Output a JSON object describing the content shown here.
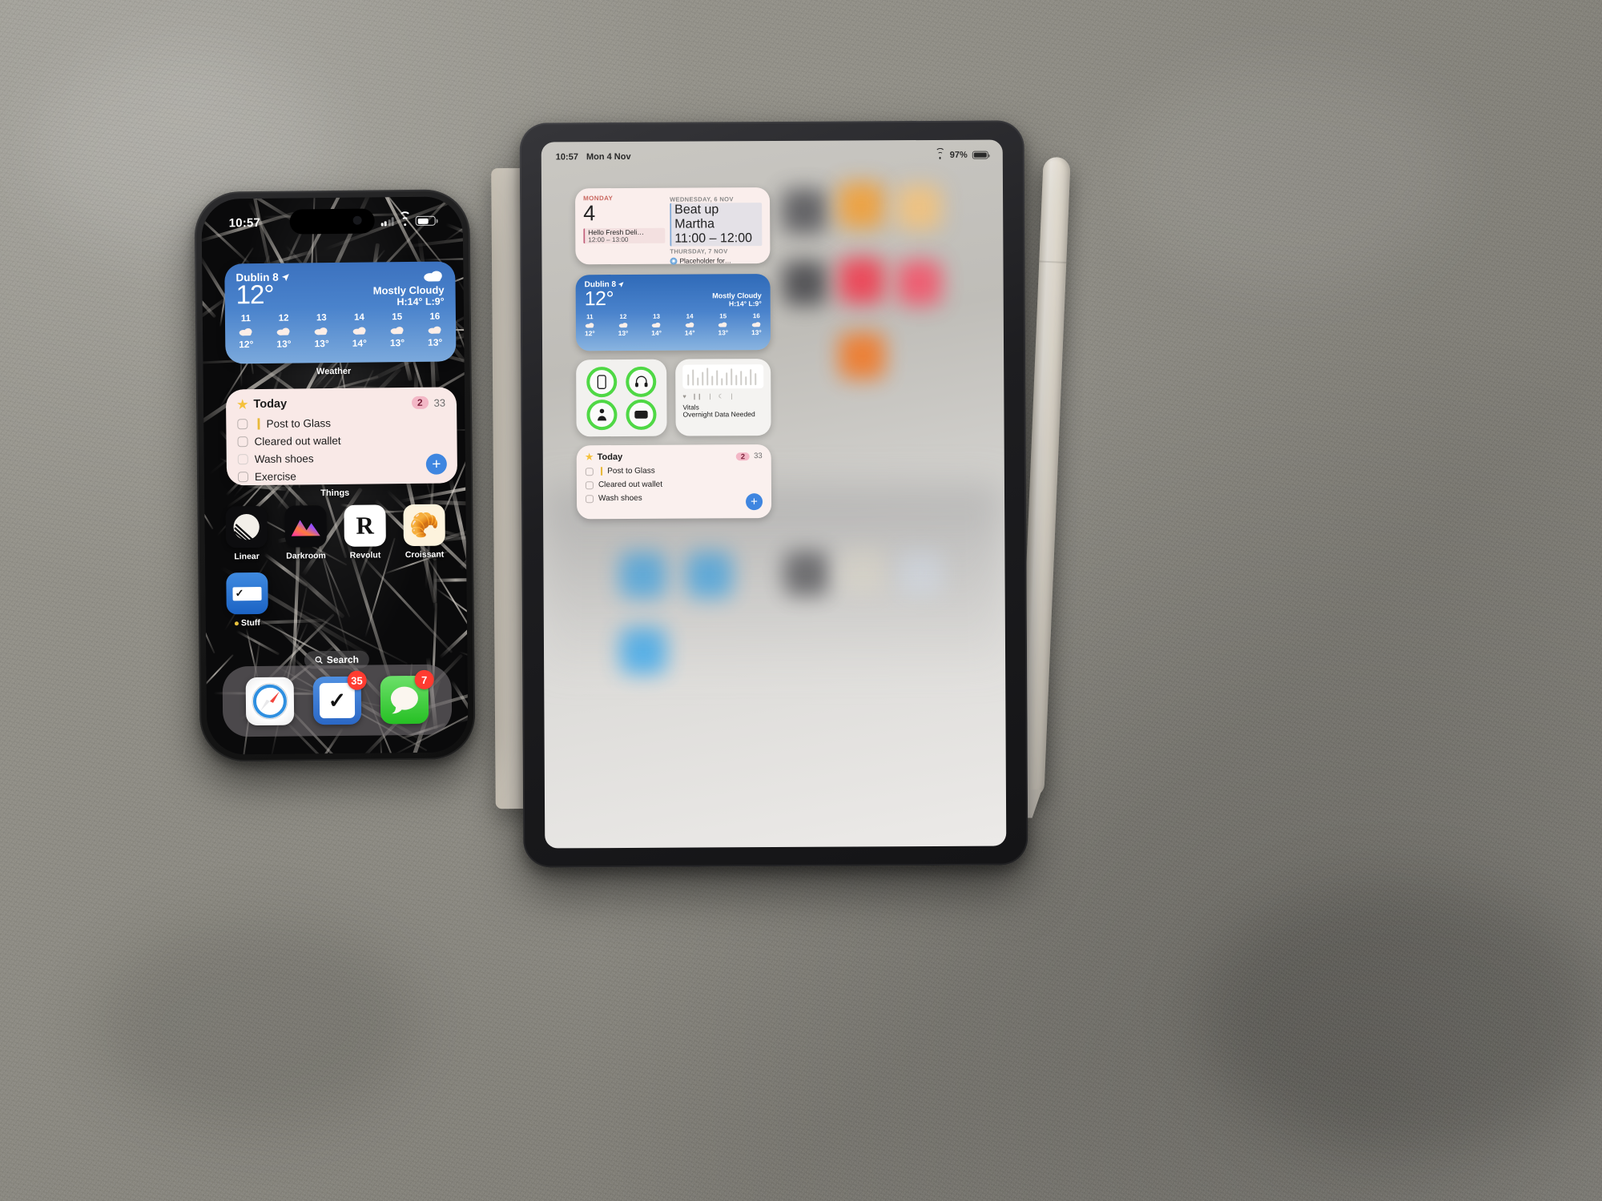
{
  "scene": {
    "description": "Photo of an iPhone and an iPad mini lying on a grey felt desk mat with an Apple Pencil",
    "surface_color": "#8b8981"
  },
  "iphone": {
    "status_bar": {
      "time": "10:57",
      "wifi_icon": "wifi-icon",
      "signal_icon": "cellular-signal-icon",
      "battery_icon": "battery-icon"
    },
    "weather_widget": {
      "city": "Dublin 8",
      "location_icon": "location-arrow-icon",
      "temperature": "12°",
      "condition": "Mostly Cloudy",
      "high_low": "H:14° L:9°",
      "condition_icon": "cloud-icon",
      "hours": [
        {
          "hour": "11",
          "icon": "cloud-icon",
          "temp": "12°"
        },
        {
          "hour": "12",
          "icon": "cloud-icon",
          "temp": "13°"
        },
        {
          "hour": "13",
          "icon": "cloud-icon",
          "temp": "13°"
        },
        {
          "hour": "14",
          "icon": "cloud-icon",
          "temp": "14°"
        },
        {
          "hour": "15",
          "icon": "cloud-icon",
          "temp": "13°"
        },
        {
          "hour": "16",
          "icon": "cloud-icon",
          "temp": "13°"
        }
      ],
      "label": "Weather"
    },
    "things_widget": {
      "title": "Today",
      "star_icon": "star-icon",
      "badge": "2",
      "count": "33",
      "tasks": [
        {
          "text": "Post to Glass",
          "flagged": true
        },
        {
          "text": "Cleared out wallet",
          "flagged": false
        },
        {
          "text": "Wash shoes",
          "flagged": false
        },
        {
          "text": "Exercise",
          "flagged": false
        }
      ],
      "add_label": "+",
      "label": "Things"
    },
    "apps": [
      {
        "name": "Linear",
        "icon": "linear-app-icon"
      },
      {
        "name": "Darkroom",
        "icon": "darkroom-app-icon"
      },
      {
        "name": "Revolut",
        "icon": "revolut-app-icon",
        "glyph": "R"
      },
      {
        "name": "Croissant",
        "icon": "croissant-app-icon",
        "glyph": "🥐"
      },
      {
        "name": "Stuff",
        "icon": "stuff-app-icon",
        "has_dot": true
      }
    ],
    "search": {
      "label": "Search",
      "icon": "search-icon"
    },
    "dock": [
      {
        "name": "Safari",
        "icon": "safari-app-icon",
        "badge": ""
      },
      {
        "name": "Things",
        "icon": "things-app-icon",
        "badge": "35"
      },
      {
        "name": "Messages",
        "icon": "messages-app-icon",
        "badge": "7"
      }
    ]
  },
  "ipad": {
    "status_bar": {
      "time": "10:57",
      "date": "Mon 4 Nov",
      "battery_text": "97%",
      "wifi_icon": "wifi-icon",
      "battery_icon": "battery-icon"
    },
    "calendar_widget": {
      "left": {
        "weekday": "MONDAY",
        "day_number": "4",
        "event": {
          "title": "Hello Fresh Deli…",
          "time": "12:00 – 13:00"
        }
      },
      "right": {
        "day_header_1": "WEDNESDAY, 6 NOV",
        "event_1": {
          "title": "Beat up Martha",
          "time": "11:00 – 12:00"
        },
        "day_header_2": "THURSDAY, 7 NOV",
        "event_2": {
          "title": "Placeholder for…",
          "icon": "calendar-dot-icon"
        }
      }
    },
    "weather_widget": {
      "city": "Dublin 8",
      "location_icon": "location-arrow-icon",
      "temperature": "12°",
      "condition": "Mostly Cloudy",
      "high_low": "H:14° L:9°",
      "hours": [
        {
          "hour": "11",
          "icon": "cloud-icon",
          "temp": "12°"
        },
        {
          "hour": "12",
          "icon": "cloud-icon",
          "temp": "13°"
        },
        {
          "hour": "13",
          "icon": "cloud-icon",
          "temp": "14°"
        },
        {
          "hour": "14",
          "icon": "cloud-icon",
          "temp": "14°"
        },
        {
          "hour": "15",
          "icon": "cloud-icon",
          "temp": "13°"
        },
        {
          "hour": "16",
          "icon": "cloud-icon",
          "temp": "13°"
        }
      ]
    },
    "controls_widget": {
      "items": [
        {
          "icon": "iphone-icon",
          "state": "active"
        },
        {
          "icon": "headphones-icon",
          "state": "active"
        },
        {
          "icon": "person-icon",
          "state": "active"
        },
        {
          "icon": "trackpad-icon",
          "state": "active"
        }
      ],
      "ring_color": "#4fd845"
    },
    "vitals_widget": {
      "title": "Vitals",
      "status": "Overnight Data Needed",
      "graph_icon": "sleep-graph-icon"
    },
    "things_widget": {
      "title": "Today",
      "star_icon": "star-icon",
      "badge": "2",
      "count": "33",
      "tasks": [
        {
          "text": "Post to Glass",
          "flagged": true
        },
        {
          "text": "Cleared out wallet",
          "flagged": false
        },
        {
          "text": "Wash shoes",
          "flagged": false
        }
      ],
      "add_label": "+"
    }
  },
  "pencil": {
    "name": "Apple Pencil"
  }
}
